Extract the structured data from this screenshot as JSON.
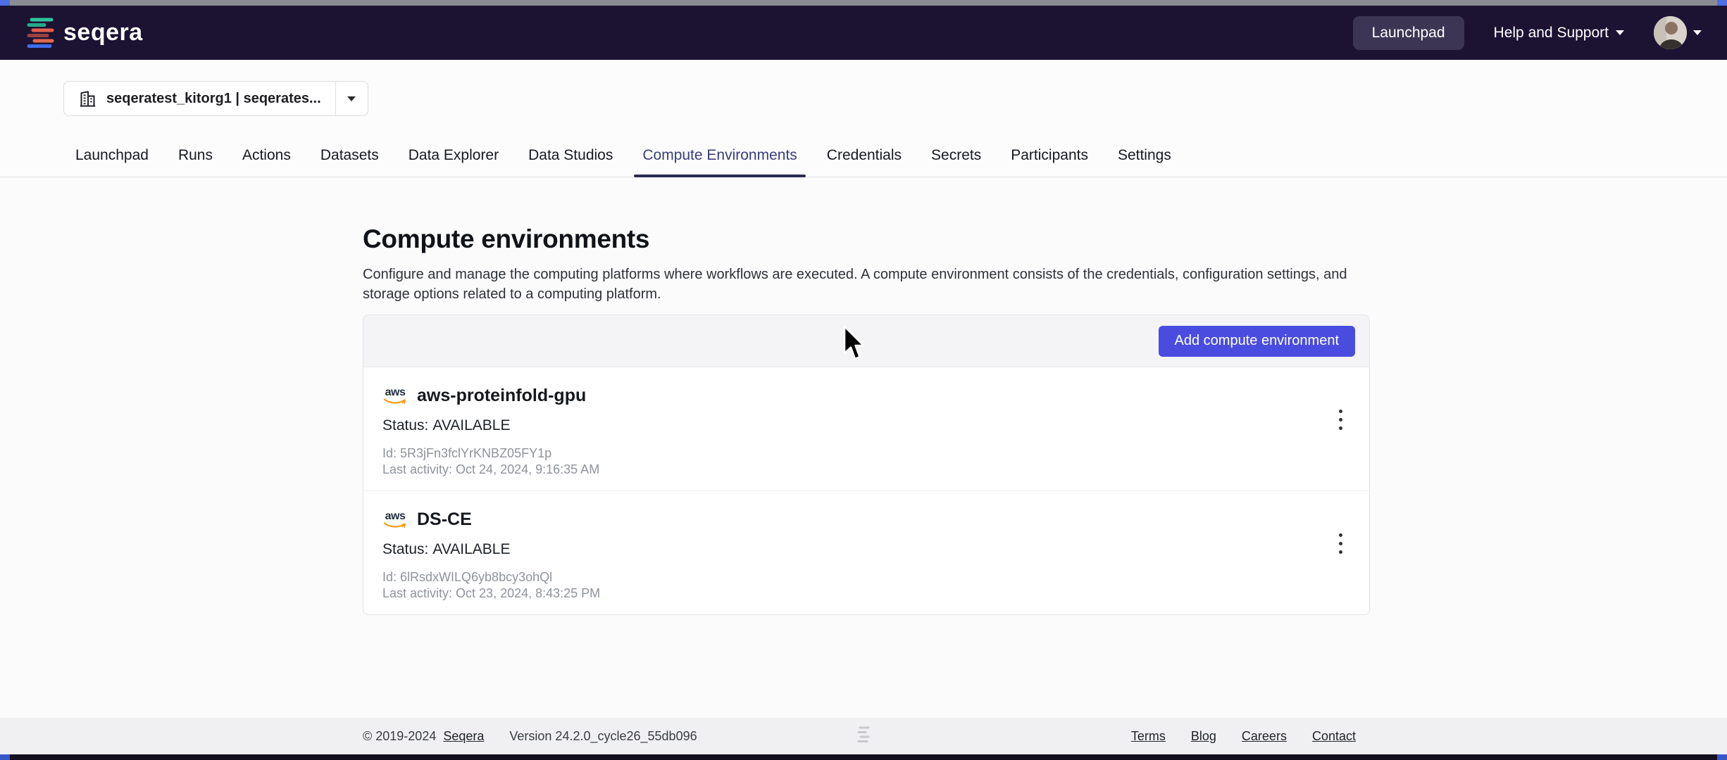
{
  "header": {
    "brand": "seqera",
    "launchpad_button": "Launchpad",
    "help_menu": "Help and Support"
  },
  "workspace_selector": {
    "label": "seqeratest_kitorg1 | seqerates..."
  },
  "tabs": [
    {
      "label": "Launchpad"
    },
    {
      "label": "Runs"
    },
    {
      "label": "Actions"
    },
    {
      "label": "Datasets"
    },
    {
      "label": "Data Explorer"
    },
    {
      "label": "Data Studios"
    },
    {
      "label": "Compute Environments",
      "active": true
    },
    {
      "label": "Credentials"
    },
    {
      "label": "Secrets"
    },
    {
      "label": "Participants"
    },
    {
      "label": "Settings"
    }
  ],
  "main": {
    "title": "Compute environments",
    "description": "Configure and manage the computing platforms where workflows are executed. A compute environment consists of the credentials, configuration settings, and storage options related to a computing platform.",
    "add_button": "Add compute environment"
  },
  "environments": [
    {
      "provider": "aws",
      "name": "aws-proteinfold-gpu",
      "status_label": "Status:",
      "status_value": "AVAILABLE",
      "id_label": "Id:",
      "id_value": "5R3jFn3fclYrKNBZ05FY1p",
      "last_activity_label": "Last activity:",
      "last_activity_value": "Oct 24, 2024, 9:16:35 AM"
    },
    {
      "provider": "aws",
      "name": "DS-CE",
      "status_label": "Status:",
      "status_value": "AVAILABLE",
      "id_label": "Id:",
      "id_value": "6lRsdxWILQ6yb8bcy3ohQl",
      "last_activity_label": "Last activity:",
      "last_activity_value": "Oct 23, 2024, 8:43:25 PM"
    }
  ],
  "footer": {
    "copyright": "© 2019-2024",
    "company_link": "Seqera",
    "version": "Version 24.2.0_cycle26_55db096",
    "links": [
      {
        "label": "Terms"
      },
      {
        "label": "Blog"
      },
      {
        "label": "Careers"
      },
      {
        "label": "Contact"
      }
    ]
  },
  "colors": {
    "accent": "#4a4ce0",
    "header_bg": "#1c1333",
    "active_tab": "#383d79"
  }
}
